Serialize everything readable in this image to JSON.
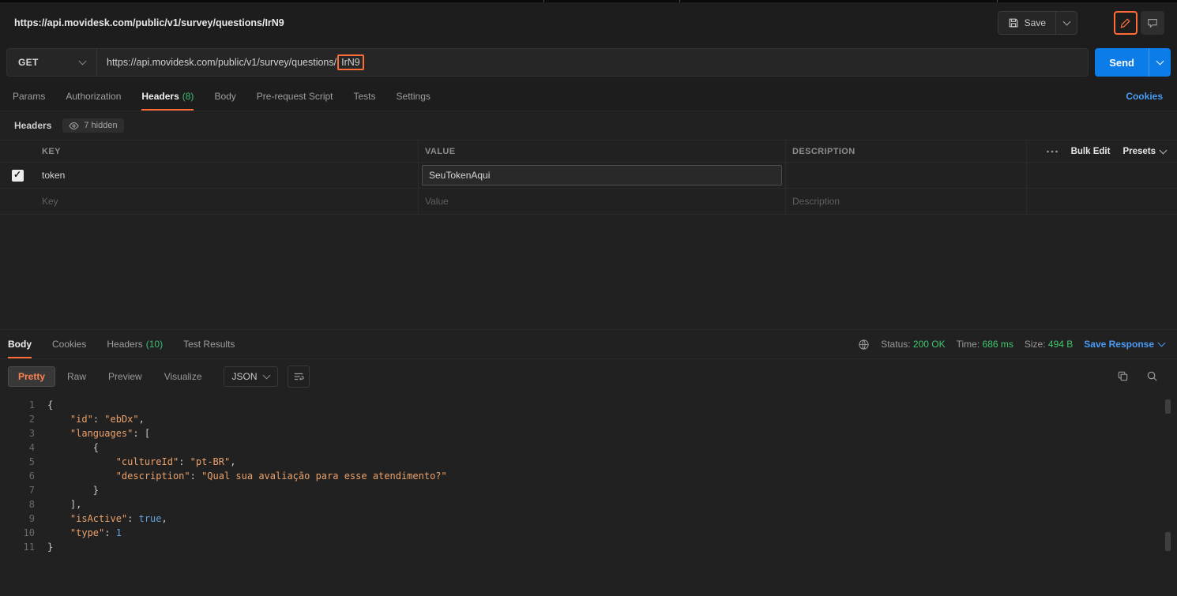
{
  "colors": {
    "accent_orange": "#ff6c37",
    "send_blue": "#0b7ce8",
    "link_blue": "#4a9cf7",
    "success_green": "#3ec76c"
  },
  "icons": {
    "save-icon": "floppy",
    "chevron-down-icon": "chevron",
    "pencil-icon": "pencil",
    "comments-icon": "speech-bubble",
    "eye-icon": "eye",
    "more-options-icon": "three-dots",
    "checkbox-check-icon": "check",
    "network-icon": "globe",
    "wrap-text-icon": "wrap-lines",
    "copy-icon": "copy",
    "search-icon": "magnifier"
  },
  "topbar": {
    "tab_title": "https://api.movidesk.com/public/v1/survey/questions/IrN9",
    "save_label": "Save"
  },
  "request": {
    "method": "GET",
    "url_prefix": "https://api.movidesk.com/public/v1/survey/questions/",
    "url_highlight": "IrN9",
    "send_label": "Send",
    "cookies_link": "Cookies",
    "tabs": [
      {
        "label": "Params"
      },
      {
        "label": "Authorization"
      },
      {
        "label": "Headers",
        "count": "(8)",
        "active": true
      },
      {
        "label": "Body"
      },
      {
        "label": "Pre-request Script"
      },
      {
        "label": "Tests"
      },
      {
        "label": "Settings"
      }
    ]
  },
  "headers_editor": {
    "title": "Headers",
    "hidden_badge": "7 hidden",
    "columns": {
      "key": "KEY",
      "value": "VALUE",
      "description": "DESCRIPTION"
    },
    "bulk_edit_label": "Bulk Edit",
    "presets_label": "Presets",
    "rows": [
      {
        "key": "token",
        "value": "SeuTokenAqui",
        "description": ""
      }
    ],
    "placeholder_row": {
      "key": "Key",
      "value": "Value",
      "description": "Description"
    }
  },
  "response": {
    "tabs": [
      {
        "label": "Body",
        "active": true
      },
      {
        "label": "Cookies"
      },
      {
        "label": "Headers",
        "count": "(10)"
      },
      {
        "label": "Test Results"
      }
    ],
    "meta": {
      "status_label": "Status:",
      "status_value": "200 OK",
      "time_label": "Time:",
      "time_value": "686 ms",
      "size_label": "Size:",
      "size_value": "494 B",
      "save_response_label": "Save Response"
    },
    "view_tabs": [
      {
        "label": "Pretty",
        "active": true
      },
      {
        "label": "Raw"
      },
      {
        "label": "Preview"
      },
      {
        "label": "Visualize"
      }
    ],
    "format": "JSON",
    "code_lines": [
      [
        {
          "t": "punc",
          "v": "{"
        }
      ],
      [
        {
          "t": "ws",
          "v": "    "
        },
        {
          "t": "key",
          "v": "\"id\""
        },
        {
          "t": "punc",
          "v": ": "
        },
        {
          "t": "str",
          "v": "\"ebDx\""
        },
        {
          "t": "punc",
          "v": ","
        }
      ],
      [
        {
          "t": "ws",
          "v": "    "
        },
        {
          "t": "key",
          "v": "\"languages\""
        },
        {
          "t": "punc",
          "v": ": ["
        }
      ],
      [
        {
          "t": "ws",
          "v": "        "
        },
        {
          "t": "punc",
          "v": "{"
        }
      ],
      [
        {
          "t": "ws",
          "v": "            "
        },
        {
          "t": "key",
          "v": "\"cultureId\""
        },
        {
          "t": "punc",
          "v": ": "
        },
        {
          "t": "str",
          "v": "\"pt-BR\""
        },
        {
          "t": "punc",
          "v": ","
        }
      ],
      [
        {
          "t": "ws",
          "v": "            "
        },
        {
          "t": "key",
          "v": "\"description\""
        },
        {
          "t": "punc",
          "v": ": "
        },
        {
          "t": "str",
          "v": "\"Qual sua avaliação para esse atendimento?\""
        }
      ],
      [
        {
          "t": "ws",
          "v": "        "
        },
        {
          "t": "punc",
          "v": "}"
        }
      ],
      [
        {
          "t": "ws",
          "v": "    "
        },
        {
          "t": "punc",
          "v": "],"
        }
      ],
      [
        {
          "t": "ws",
          "v": "    "
        },
        {
          "t": "key",
          "v": "\"isActive\""
        },
        {
          "t": "punc",
          "v": ": "
        },
        {
          "t": "bool",
          "v": "true"
        },
        {
          "t": "punc",
          "v": ","
        }
      ],
      [
        {
          "t": "ws",
          "v": "    "
        },
        {
          "t": "key",
          "v": "\"type\""
        },
        {
          "t": "punc",
          "v": ": "
        },
        {
          "t": "num",
          "v": "1"
        }
      ],
      [
        {
          "t": "punc",
          "v": "}"
        }
      ]
    ]
  }
}
